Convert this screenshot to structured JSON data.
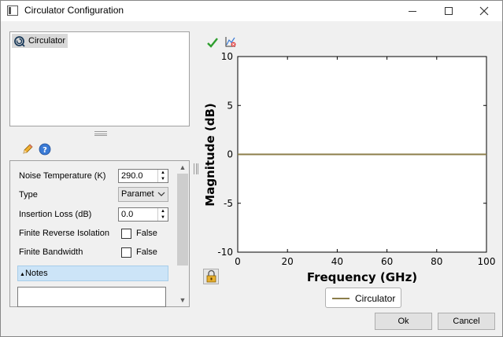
{
  "window": {
    "title": "Circulator Configuration"
  },
  "tree": {
    "items": [
      {
        "label": "Circulator"
      }
    ]
  },
  "properties": {
    "noise_temperature": {
      "label": "Noise Temperature (K)",
      "value": "290.0"
    },
    "type": {
      "label": "Type",
      "value": "Paramet"
    },
    "insertion_loss": {
      "label": "Insertion Loss (dB)",
      "value": "0.0"
    },
    "finite_reverse_isolation": {
      "label": "Finite Reverse Isolation",
      "value": "False"
    },
    "finite_bandwidth": {
      "label": "Finite Bandwidth",
      "value": "False"
    },
    "notes": {
      "label": "Notes"
    }
  },
  "chart_data": {
    "type": "line",
    "xlabel": "Frequency (GHz)",
    "ylabel": "Magnitude (dB)",
    "xlim": [
      0,
      100
    ],
    "ylim": [
      -10,
      10
    ],
    "xticks": [
      0,
      20,
      40,
      60,
      80,
      100
    ],
    "yticks": [
      10,
      5,
      0,
      -5,
      -10
    ],
    "grid": false,
    "legend": "bottom-center",
    "series": [
      {
        "name": "Circulator",
        "color": "#8b7d4a",
        "x": [
          0,
          100
        ],
        "y": [
          0,
          0
        ]
      }
    ]
  },
  "buttons": {
    "ok": "Ok",
    "cancel": "Cancel"
  },
  "colors": {
    "selection": "#cce4f7",
    "series": "#8b7d4a"
  }
}
